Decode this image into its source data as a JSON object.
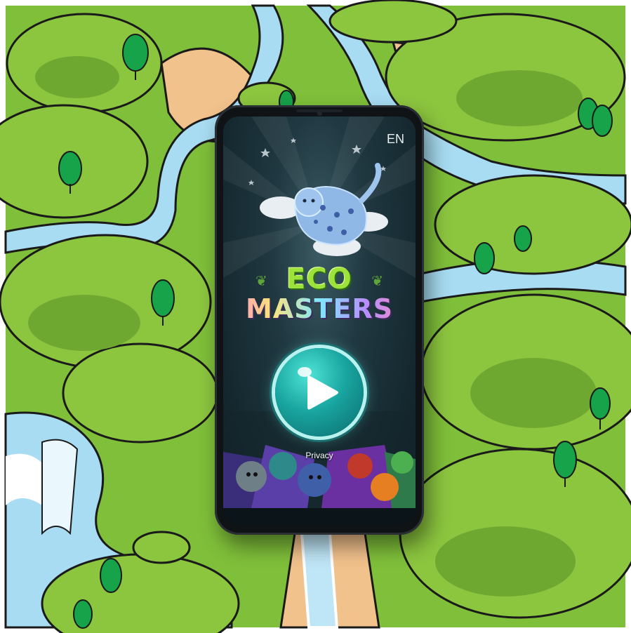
{
  "game": {
    "title_line1": "ECO",
    "title_line2": "MASTERS"
  },
  "header": {
    "language": "EN"
  },
  "footer": {
    "privacy_label": "Privacy"
  },
  "colors": {
    "forest_green": "#8cc63f",
    "river_blue": "#a8dcf2",
    "sand": "#f2c28c",
    "play_teal": "#19a5a0"
  },
  "icons": [
    "play-icon",
    "jaguar-mascot",
    "leaf-icon"
  ]
}
